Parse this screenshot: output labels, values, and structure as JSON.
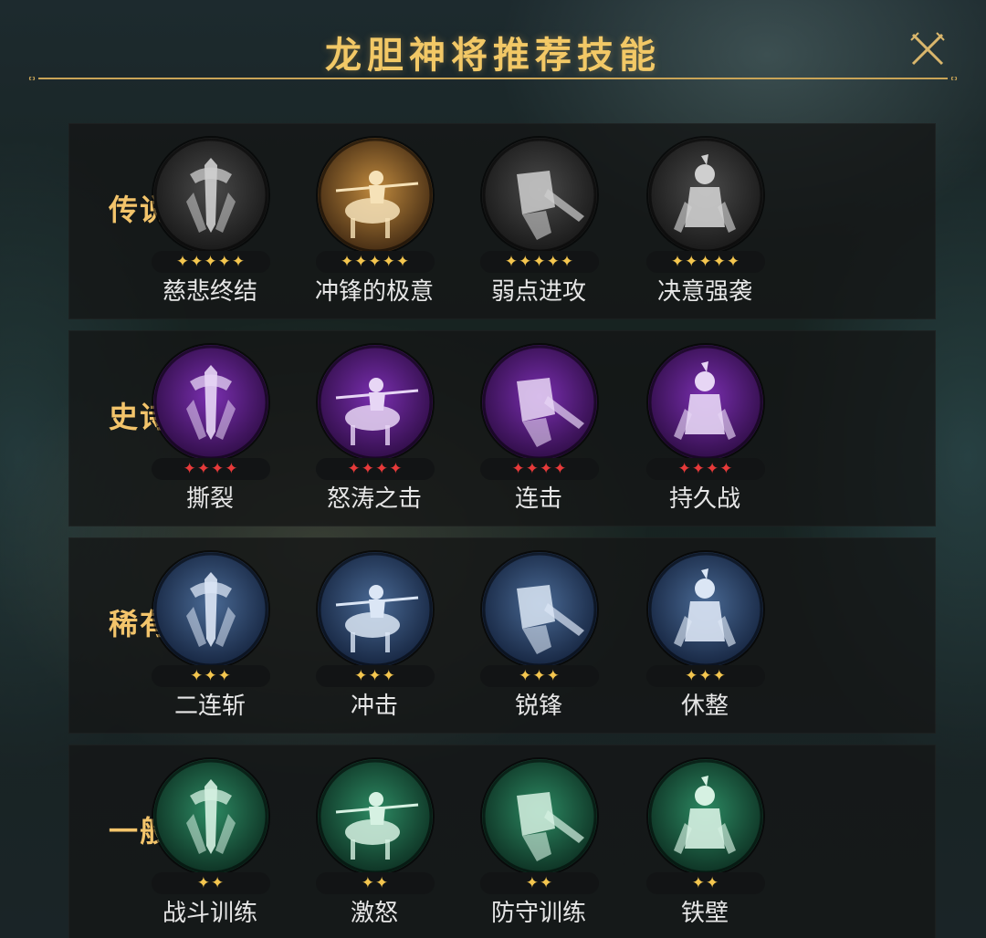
{
  "title": "龙胆神将推荐技能",
  "colors": {
    "gold": "#f3c46b",
    "star_gold": "#f4c64f",
    "star_red": "#e63a3a"
  },
  "sections": [
    {
      "label": "传说",
      "skills": [
        {
          "name": "慈悲终结",
          "stars": "✦✦✦✦✦",
          "icon": "sword-cape-icon"
        },
        {
          "name": "冲锋的极意",
          "stars": "✦✦✦✦✦",
          "icon": "cavalry-charge-icon"
        },
        {
          "name": "弱点进攻",
          "stars": "✦✦✦✦✦",
          "icon": "armor-pierce-icon"
        },
        {
          "name": "决意强袭",
          "stars": "✦✦✦✦✦",
          "icon": "rearing-horse-icon"
        }
      ]
    },
    {
      "label": "史诗",
      "skills": [
        {
          "name": "撕裂",
          "stars": "✦✦✦✦",
          "icon": "tear-arm-icon"
        },
        {
          "name": "怒涛之击",
          "stars": "✦✦✦✦",
          "icon": "spear-strike-icon"
        },
        {
          "name": "连击",
          "stars": "✦✦✦✦",
          "icon": "combo-swords-icon"
        },
        {
          "name": "持久战",
          "stars": "✦✦✦✦",
          "icon": "armored-knight-icon"
        }
      ]
    },
    {
      "label": "稀有",
      "skills": [
        {
          "name": "二连斩",
          "stars": "✦✦✦",
          "icon": "double-slash-icon"
        },
        {
          "name": "冲击",
          "stars": "✦✦✦",
          "icon": "lance-thrust-icon"
        },
        {
          "name": "锐锋",
          "stars": "✦✦✦",
          "icon": "sharp-blade-icon"
        },
        {
          "name": "休整",
          "stars": "✦✦✦",
          "icon": "horse-rest-icon"
        }
      ]
    },
    {
      "label": "一般",
      "skills": [
        {
          "name": "战斗训练",
          "stars": "✦✦",
          "icon": "soldiers-icon"
        },
        {
          "name": "激怒",
          "stars": "✦✦",
          "icon": "roaring-warrior-icon"
        },
        {
          "name": "防守训练",
          "stars": "✦✦",
          "icon": "shield-wall-icon"
        },
        {
          "name": "铁壁",
          "stars": "✦✦",
          "icon": "iron-shield-icon"
        }
      ]
    }
  ]
}
